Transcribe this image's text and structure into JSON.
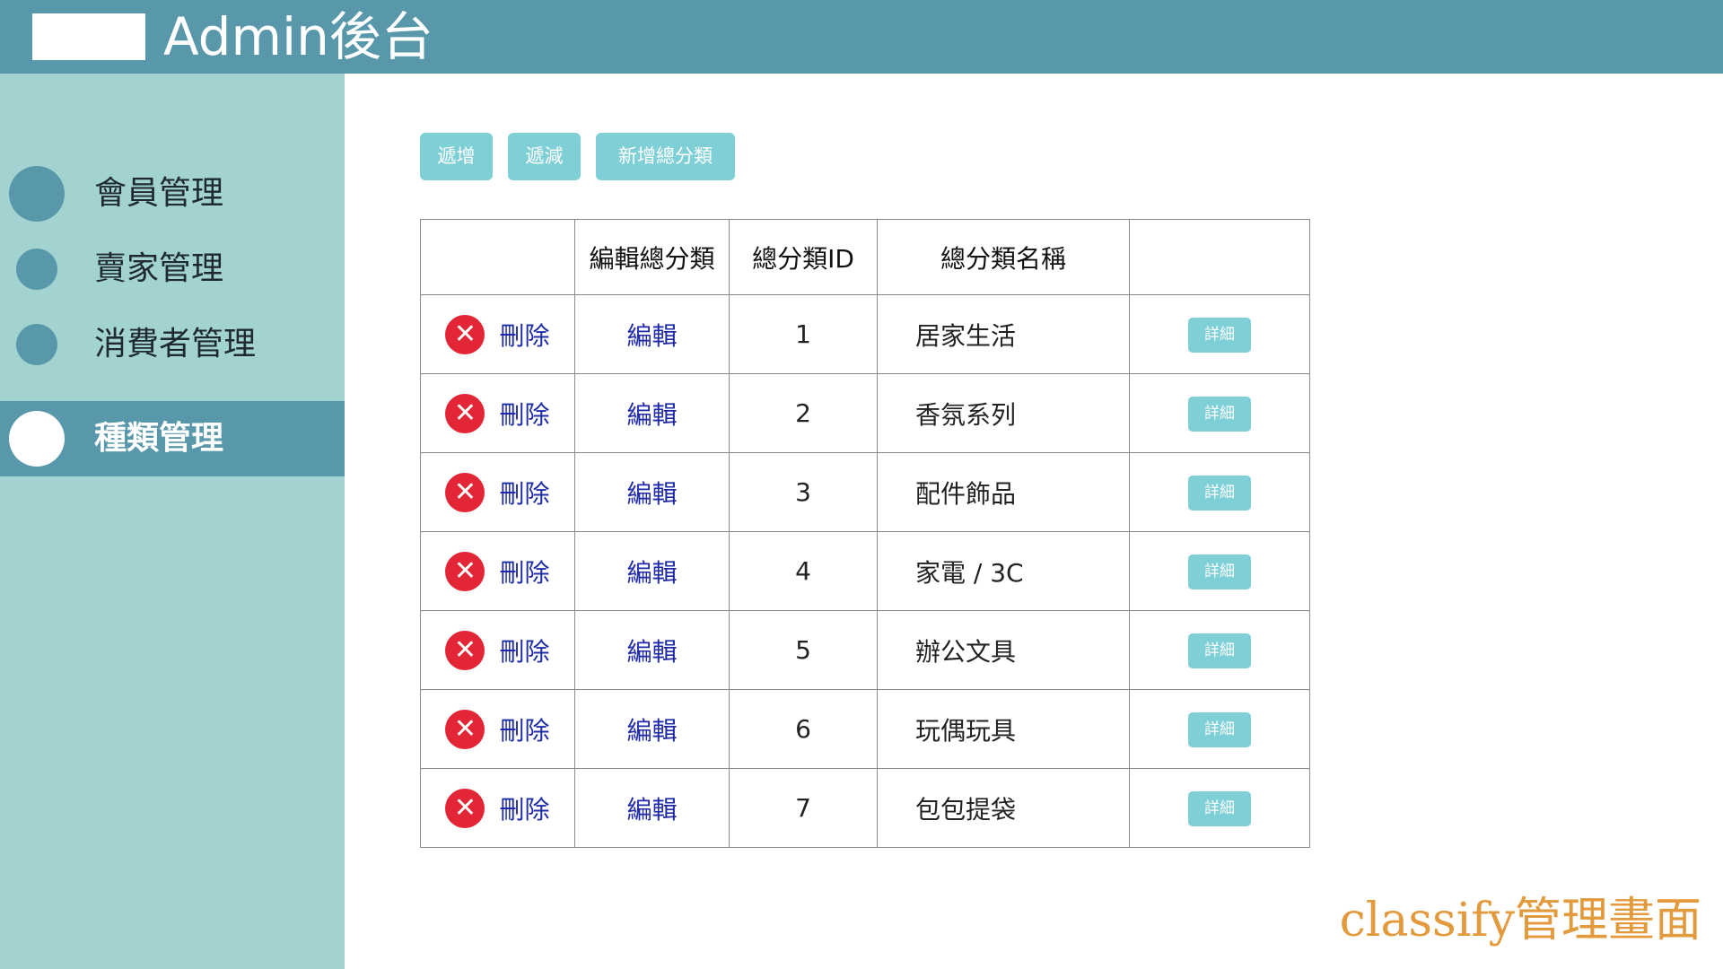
{
  "header": {
    "title": "Admin後台"
  },
  "sidebar": {
    "items": [
      {
        "label": "會員管理"
      },
      {
        "label": "賣家管理"
      },
      {
        "label": "消費者管理"
      },
      {
        "label": "種類管理"
      }
    ]
  },
  "toolbar": {
    "add_row_label": "遞增",
    "remove_row_label": "遞減",
    "new_category_label": "新增總分類"
  },
  "table": {
    "headers": [
      "",
      "編輯總分類",
      "總分類ID",
      "總分類名稱",
      ""
    ],
    "delete_label": "刪除",
    "edit_label": "編輯",
    "detail_label": "詳細",
    "rows": [
      {
        "id": "1",
        "name": "居家生活"
      },
      {
        "id": "2",
        "name": "香氛系列"
      },
      {
        "id": "3",
        "name": "配件飾品"
      },
      {
        "id": "4",
        "name": "家電 / 3C"
      },
      {
        "id": "5",
        "name": "辦公文具"
      },
      {
        "id": "6",
        "name": "玩偶玩具"
      },
      {
        "id": "7",
        "name": "包包提袋"
      }
    ]
  },
  "footer": {
    "caption": "classify管理畫面"
  },
  "colors": {
    "header_bg": "#5898aa",
    "sidebar_bg": "#a2d3d0",
    "button_bg": "#7ecfd6",
    "delete_red": "#e32636",
    "link_blue": "#1f2aa8",
    "caption_orange": "#e39a3c"
  },
  "icons": {
    "delete": "close-circle-icon",
    "nav": "circle-dot-icon"
  }
}
